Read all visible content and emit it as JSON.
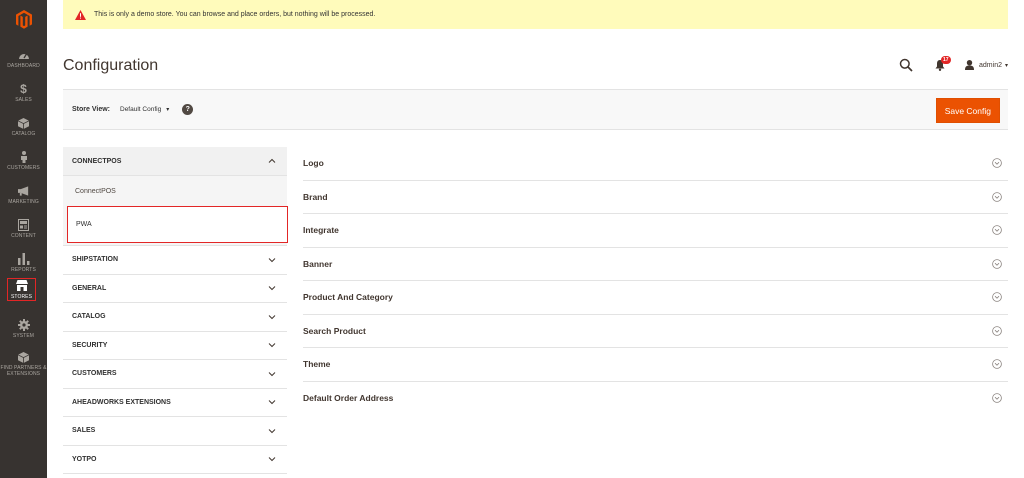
{
  "notice": {
    "text": "This is only a demo store. You can browse and place orders, but nothing will be processed."
  },
  "header": {
    "title": "Configuration",
    "notification_count": "17",
    "user_name": "admin2"
  },
  "sidebar": {
    "items": [
      {
        "label": "DASHBOARD",
        "icon": "dashboard-icon"
      },
      {
        "label": "SALES",
        "icon": "dollar-icon"
      },
      {
        "label": "CATALOG",
        "icon": "cube-icon"
      },
      {
        "label": "CUSTOMERS",
        "icon": "person-icon"
      },
      {
        "label": "MARKETING",
        "icon": "megaphone-icon"
      },
      {
        "label": "CONTENT",
        "icon": "content-icon"
      },
      {
        "label": "REPORTS",
        "icon": "bar-chart-icon"
      },
      {
        "label": "STORES",
        "icon": "store-icon",
        "active": true
      },
      {
        "label": "SYSTEM",
        "icon": "gear-icon"
      },
      {
        "label": "FIND PARTNERS & EXTENSIONS",
        "icon": "box-icon"
      }
    ]
  },
  "storebar": {
    "label": "Store View:",
    "value": "Default Config",
    "save_label": "Save Config"
  },
  "leftnav": {
    "open_section": "CONNECTPOS",
    "sub_items": [
      "ConnectPOS",
      "PWA"
    ],
    "sections": [
      "SHIPSTATION",
      "GENERAL",
      "CATALOG",
      "SECURITY",
      "CUSTOMERS",
      "AHEADWORKS EXTENSIONS",
      "SALES",
      "YOTPO"
    ]
  },
  "groups": [
    "Logo",
    "Brand",
    "Integrate",
    "Banner",
    "Product And Category",
    "Search Product",
    "Theme",
    "Default Order Address"
  ],
  "colors": {
    "sidebar": "#373330",
    "accent": "#eb5202",
    "notice": "#fffbbb",
    "highlight": "#e22626"
  }
}
